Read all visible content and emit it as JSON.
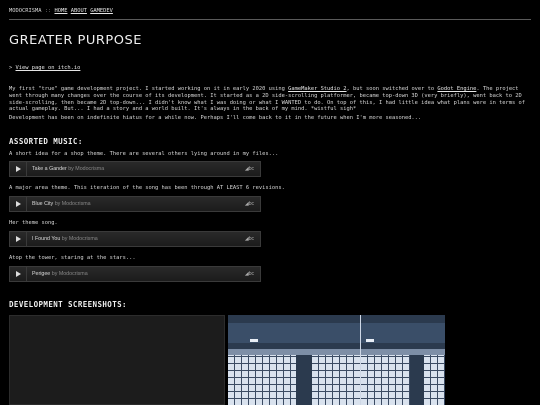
{
  "nav": {
    "site": "MODOCRISMA",
    "separator": "::",
    "links": [
      "HOME",
      "ABOUT",
      "GAMEDEV"
    ]
  },
  "title": "GREATER PURPOSE",
  "itch": {
    "prefix": ">",
    "link": "View page on itch.io"
  },
  "intro": {
    "part1": "My first \"true\" game development project. I started working on it in early 2020 using ",
    "link1": "GameMaker Studio 2",
    "part2": ", but soon switched over to ",
    "link2": "Godot Engine",
    "part3": ". The project went through many changes over the course of its development. It started as a 2D side-scrolling platformer, became top-down 3D (very briefly), went back to 2D side-scrolling, then became 2D top-down... I didn't know what I was doing or what I WANTED to do. On top of this, I had little idea what plans were in terms of actual gameplay. But... I had a story and a world built. It's always in the back of my mind. *wistful sigh*"
  },
  "hiatus": "Development has been on indefinite hiatus for a while now. Perhaps I'll come back to it in the future when I'm more seasoned...",
  "music": {
    "heading": "ASSORTED MUSIC:",
    "tracks": [
      {
        "desc": "A short idea for a shop theme. There are several others lying around in my files...",
        "name": "Take a Gander",
        "by": "by Modocrisma",
        "badge": "bc"
      },
      {
        "desc": "A major area theme. This iteration of the song has been through AT LEAST 6 revisions.",
        "name": "Blue City",
        "by": "by Modocrisma",
        "badge": "bc"
      },
      {
        "desc": "Her theme song.",
        "name": "I Found You",
        "by": "by Modocrisma",
        "badge": "bc"
      },
      {
        "desc": "Atop the tower, staring at the stars...",
        "name": "Perigee",
        "by": "by Modocrisma",
        "badge": "bc"
      }
    ]
  },
  "screenshots": {
    "heading": "DEVELOPMENT SCREENSHOTS:"
  }
}
